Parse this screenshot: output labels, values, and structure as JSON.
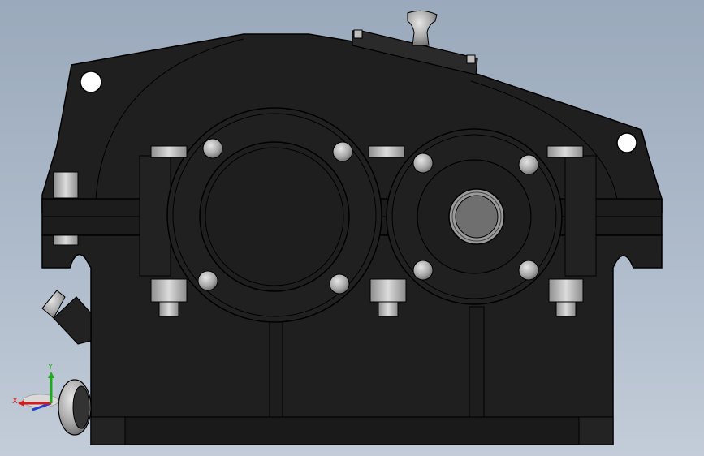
{
  "viewport": {
    "background_top": "#9aa9bb",
    "background_bottom": "#c3ccd8"
  },
  "model": {
    "body_color": "#1f1f1f",
    "edge_color": "#000000",
    "metal_color": "#b8b8b8",
    "bore_color": "#6f6f6f"
  },
  "triad": {
    "x_label": "X",
    "y_label": "Y",
    "x_color": "#d01e1e",
    "y_color": "#1faa1f",
    "z_color": "#1e3fd0"
  }
}
